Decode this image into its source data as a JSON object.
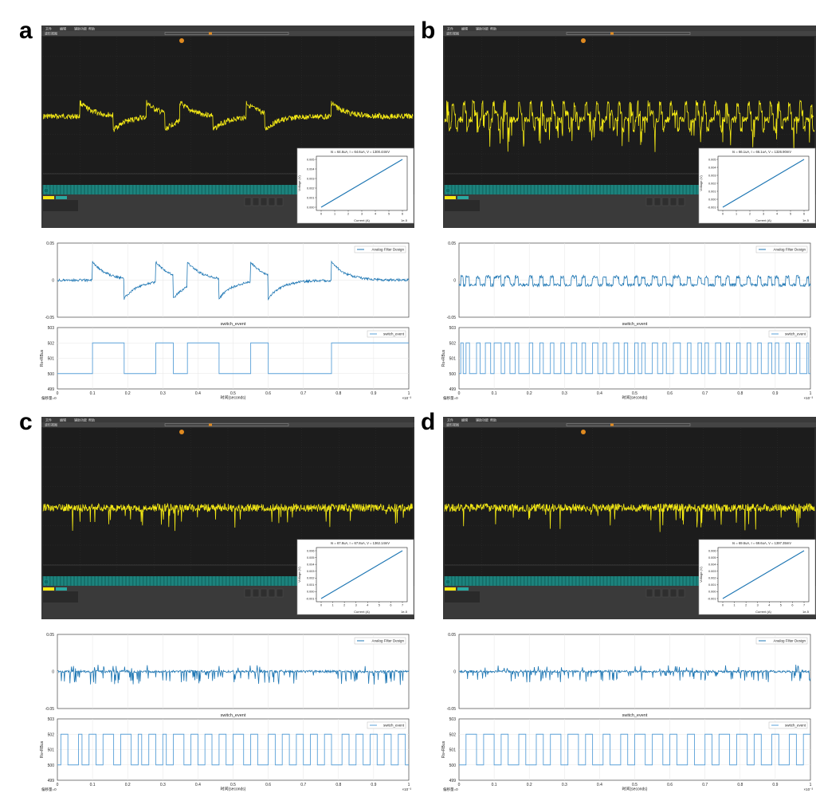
{
  "panels": [
    {
      "letter": "a",
      "scope": {
        "menu": [
          "文件",
          "编辑",
          "辅助功能",
          "帮助"
        ],
        "tab": "波形视图",
        "inset": {
          "title": "Is = 64.6uA, I = 64.6uA, V = 1300.44mV",
          "xlabel": "Current (A)",
          "ylabel": "Voltage (V)",
          "exponent": "1e-5",
          "xticks": [
            "0",
            "1",
            "2",
            "3",
            "4",
            "5",
            "6"
          ],
          "yticks": [
            "0.000",
            "0.001",
            "0.002",
            "0.003",
            "0.004",
            "0.005"
          ]
        }
      },
      "events": [
        0.1,
        0.19,
        0.28,
        0.33,
        0.37,
        0.46,
        0.55,
        0.6,
        0.78
      ]
    },
    {
      "letter": "b",
      "scope": {
        "menu": [
          "文件",
          "编辑",
          "辅助功能",
          "帮助"
        ],
        "tab": "波形视图",
        "inset": {
          "title": "Is = 66.1uA, I = 66.1uA, V = 1326.90mV",
          "xlabel": "Current (A)",
          "ylabel": "Voltage (V)",
          "exponent": "1e-5",
          "xticks": [
            "0",
            "1",
            "2",
            "3",
            "4",
            "5",
            "6"
          ],
          "yticks": [
            "-0.001",
            "0.000",
            "0.001",
            "0.002",
            "0.003",
            "0.004",
            "0.005"
          ]
        }
      },
      "events": [
        0.005,
        0.012,
        0.02,
        0.03,
        0.05,
        0.06,
        0.075,
        0.09,
        0.1,
        0.12,
        0.13,
        0.145,
        0.16,
        0.17,
        0.2,
        0.21,
        0.23,
        0.24,
        0.26,
        0.27,
        0.29,
        0.3,
        0.32,
        0.335,
        0.35,
        0.36,
        0.38,
        0.395,
        0.41,
        0.42,
        0.44,
        0.455,
        0.47,
        0.48,
        0.5,
        0.51,
        0.52,
        0.53,
        0.55,
        0.565,
        0.58,
        0.59,
        0.61,
        0.63,
        0.65,
        0.66,
        0.68,
        0.69,
        0.7,
        0.71,
        0.73,
        0.745,
        0.76,
        0.77,
        0.79,
        0.8,
        0.82,
        0.83,
        0.85,
        0.86,
        0.88,
        0.89,
        0.9,
        0.91,
        0.93,
        0.94,
        0.96,
        0.97,
        0.99,
        0.995
      ]
    },
    {
      "letter": "c",
      "scope": {
        "menu": [
          "文件",
          "编辑",
          "辅助功能",
          "帮助"
        ],
        "tab": "波形视图",
        "inset": {
          "title": "Is = 67.8uA, I = 67.8uA, V = 1362.14mV",
          "xlabel": "Current (A)",
          "ylabel": "Voltage (V)",
          "exponent": "1e-5",
          "xticks": [
            "0",
            "1",
            "2",
            "3",
            "4",
            "5",
            "6",
            "7"
          ],
          "yticks": [
            "-0.001",
            "0.000",
            "0.001",
            "0.002",
            "0.003",
            "0.004",
            "0.005",
            "0.006"
          ]
        }
      },
      "events": [
        0.01,
        0.03,
        0.06,
        0.07,
        0.09,
        0.11,
        0.13,
        0.16,
        0.18,
        0.21,
        0.23,
        0.24,
        0.26,
        0.28,
        0.3,
        0.31,
        0.33,
        0.36,
        0.38,
        0.4,
        0.42,
        0.44,
        0.46,
        0.48,
        0.5,
        0.53,
        0.55,
        0.57,
        0.6,
        0.62,
        0.64,
        0.66,
        0.68,
        0.7,
        0.72,
        0.74,
        0.76,
        0.78,
        0.81,
        0.83,
        0.85,
        0.87,
        0.89,
        0.91,
        0.93,
        0.95,
        0.97,
        0.99
      ]
    },
    {
      "letter": "d",
      "scope": {
        "menu": [
          "文件",
          "编辑",
          "辅助功能",
          "帮助"
        ],
        "tab": "波形视图",
        "inset": {
          "title": "Is = 69.6uA, I = 69.6uA, V = 1397.35mV",
          "xlabel": "Current (A)",
          "ylabel": "Voltage (V)",
          "exponent": "1e-5",
          "xticks": [
            "0",
            "1",
            "2",
            "3",
            "4",
            "5",
            "6",
            "7"
          ],
          "yticks": [
            "-0.001",
            "0.000",
            "0.001",
            "0.002",
            "0.003",
            "0.004",
            "0.005",
            "0.006"
          ]
        }
      },
      "events": [
        0.02,
        0.05,
        0.07,
        0.1,
        0.12,
        0.14,
        0.17,
        0.19,
        0.22,
        0.24,
        0.26,
        0.29,
        0.31,
        0.34,
        0.36,
        0.38,
        0.41,
        0.43,
        0.46,
        0.48,
        0.5,
        0.53,
        0.55,
        0.58,
        0.6,
        0.62,
        0.65,
        0.67,
        0.7,
        0.72,
        0.74,
        0.77,
        0.79,
        0.82,
        0.84,
        0.86,
        0.89,
        0.91,
        0.94,
        0.96,
        0.98
      ]
    }
  ],
  "filter_plot": {
    "legend": "Analog Filter Design",
    "yticks": [
      "0.05",
      "0",
      "-0.05"
    ]
  },
  "event_plot": {
    "title": "switch_event",
    "legend": "switch_event",
    "ylabel": "Rs+RBus",
    "yticks": [
      "503",
      "502",
      "501",
      "500",
      "499"
    ],
    "xticks": [
      "0",
      "0.1",
      "0.2",
      "0.3",
      "0.4",
      "0.5",
      "0.6",
      "0.7",
      "0.8",
      "0.9",
      "1"
    ],
    "xlabel": "时间(seconds)",
    "offset_label": "偏移量=0",
    "exponent": "×10⁻³"
  },
  "chart_data": [
    {
      "type": "line",
      "title": "switch_event",
      "panel": "a",
      "xlim": [
        0,
        1
      ],
      "ylim": [
        499,
        503
      ],
      "low": 500,
      "high": 502,
      "x": [
        0.1,
        0.19,
        0.28,
        0.33,
        0.37,
        0.46,
        0.55,
        0.6,
        0.78
      ]
    },
    {
      "type": "line",
      "title": "switch_event",
      "panel": "b",
      "xlim": [
        0,
        1
      ],
      "ylim": [
        499,
        503
      ],
      "low": 500,
      "high": 502
    },
    {
      "type": "line",
      "title": "switch_event",
      "panel": "c",
      "xlim": [
        0,
        1
      ],
      "ylim": [
        499,
        503
      ],
      "low": 500,
      "high": 502
    },
    {
      "type": "line",
      "title": "switch_event",
      "panel": "d",
      "xlim": [
        0,
        1
      ],
      "ylim": [
        499,
        503
      ],
      "low": 500,
      "high": 502
    }
  ],
  "colors": {
    "scope_bg": "#1c1c1c",
    "trace_yellow": "#f5ea14",
    "cyan": "#2aa8a0",
    "plot_blue": "#1f77b4",
    "event_blue": "#5aa0d8",
    "grid": "#e6e6e6"
  }
}
